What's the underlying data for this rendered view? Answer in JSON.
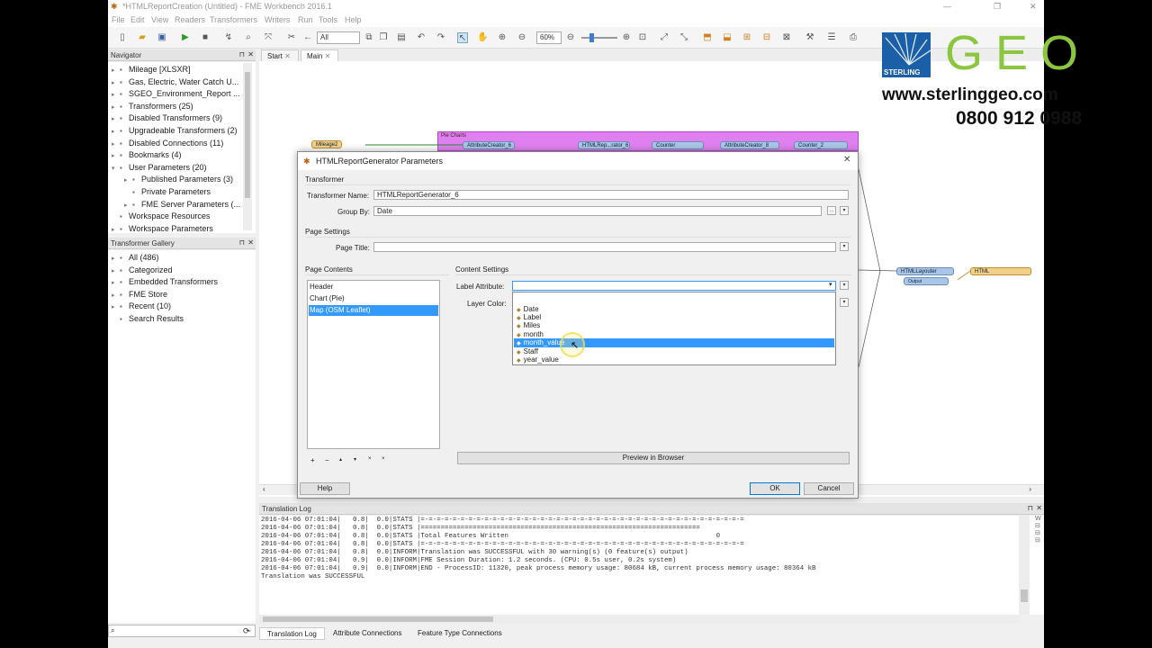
{
  "window": {
    "title": "*HTMLReportCreation (Untitled) - FME Workbench 2016.1",
    "controls": [
      "—",
      "❐",
      "✕"
    ]
  },
  "menu": [
    "File",
    "Edit",
    "View",
    "Readers",
    "Transformers",
    "Writers",
    "Run",
    "Tools",
    "Help"
  ],
  "toolbar": {
    "filter_value": "All",
    "zoom_value": "60%"
  },
  "navigator": {
    "title": "Navigator",
    "items": [
      {
        "label": "Mileage [XLSXR]",
        "indent": 0,
        "arrow": "▸"
      },
      {
        "label": "Gas, Electric, Water Catch U...",
        "indent": 0,
        "arrow": "▸"
      },
      {
        "label": "SGEO_Environment_Report ...",
        "indent": 0,
        "arrow": "▸"
      },
      {
        "label": "Transformers (25)",
        "indent": 0,
        "arrow": "▸"
      },
      {
        "label": "Disabled Transformers (9)",
        "indent": 0,
        "arrow": "▸"
      },
      {
        "label": "Upgradeable Transformers (2)",
        "indent": 0,
        "arrow": "▸"
      },
      {
        "label": "Disabled Connections (11)",
        "indent": 0,
        "arrow": "▸"
      },
      {
        "label": "Bookmarks (4)",
        "indent": 0,
        "arrow": "▸"
      },
      {
        "label": "User Parameters (20)",
        "indent": 0,
        "arrow": "▾"
      },
      {
        "label": "Published Parameters (3)",
        "indent": 1,
        "arrow": "▸"
      },
      {
        "label": "Private Parameters",
        "indent": 1,
        "arrow": ""
      },
      {
        "label": "FME Server Parameters (...",
        "indent": 1,
        "arrow": "▸"
      },
      {
        "label": "Workspace Resources",
        "indent": 0,
        "arrow": ""
      },
      {
        "label": "Workspace Parameters",
        "indent": 0,
        "arrow": "▸"
      }
    ]
  },
  "gallery": {
    "title": "Transformer Gallery",
    "items": [
      {
        "label": "All (486)",
        "arrow": "▸"
      },
      {
        "label": "Categorized",
        "arrow": "▸"
      },
      {
        "label": "Embedded Transformers",
        "arrow": "▸"
      },
      {
        "label": "FME Store",
        "arrow": "▸"
      },
      {
        "label": "Recent (10)",
        "arrow": "▸"
      },
      {
        "label": "Search Results",
        "arrow": ""
      }
    ],
    "search_placeholder": ""
  },
  "tabs": [
    {
      "label": "Start"
    },
    {
      "label": "Main"
    }
  ],
  "canvas": {
    "bookmark_label": "Pie Charts",
    "nodes": [
      "Mileage2",
      "AttributeCreator_6",
      "HTMLRep...rator_6",
      "Counter",
      "AttributeCreator_8",
      "Counter_2",
      "HTMLLayouter",
      "Output",
      "HTML"
    ]
  },
  "dialog": {
    "title": "HTMLReportGenerator Parameters",
    "transformer_section": "Transformer",
    "transformer_name_label": "Transformer Name:",
    "transformer_name_value": "HTMLReportGenerator_6",
    "group_by_label": "Group By:",
    "group_by_value": "Date",
    "page_settings_section": "Page Settings",
    "page_title_label": "Page Title:",
    "page_title_value": "",
    "page_contents_section": "Page Contents",
    "page_contents": [
      "Header",
      "Chart (Pie)",
      "Map (OSM Leaflet)"
    ],
    "selected_content": "Map (OSM Leaflet)",
    "content_settings_section": "Content Settings",
    "label_attribute_label": "Label Attribute:",
    "label_attribute_value": "",
    "layer_color_label": "Layer Color:",
    "dropdown_options": [
      "Date",
      "Label",
      "Miles",
      "month",
      "month_value",
      "Staff",
      "year_value"
    ],
    "dropdown_highlighted": "month_value",
    "list_tools": [
      "+",
      "−",
      "▴",
      "▾",
      "×",
      "×"
    ],
    "preview_button": "Preview in Browser",
    "help_button": "Help",
    "ok_button": "OK",
    "cancel_button": "Cancel",
    "ellipsis": "..."
  },
  "translation_log": {
    "title": "Translation Log",
    "lines": [
      "2016-04-06 07:01:04|   0.8|  0.0|STATS |=-=-=-=-=-=-=-=-=-=-=-=-=-=-=-=-=-=-=-=-=-=-=-=-=-=-=-=-=-=-=-=-=-=-=-=-=-=-=-=-=",
      "2016-04-06 07:01:04|   0.8|  0.0|STATS |======================================================================",
      "2016-04-06 07:01:04|   0.8|  0.0|STATS |Total Features Written                                                    0",
      "2016-04-06 07:01:04|   0.8|  0.0|STATS |=-=-=-=-=-=-=-=-=-=-=-=-=-=-=-=-=-=-=-=-=-=-=-=-=-=-=-=-=-=-=-=-=-=-=-=-=-=-=-=-=",
      "2016-04-06 07:01:04|   0.8|  0.0|INFORM|Translation was SUCCESSFUL with 30 warning(s) (0 feature(s) output)",
      "2016-04-06 07:01:04|   0.9|  0.0|INFORM|FME Session Duration: 1.2 seconds. (CPU: 0.5s user, 0.2s system)",
      "2016-04-06 07:01:04|   0.9|  0.0|INFORM|END - ProcessID: 11320, peak process memory usage: 80684 kB, current process memory usage: 80364 kB",
      "Translation was SUCCESSFUL"
    ]
  },
  "bottom_tabs": [
    "Translation Log",
    "Attribute Connections",
    "Feature Type Connections"
  ],
  "branding": {
    "company": "STERLING",
    "geo": "GEO",
    "website": "www.sterlinggeo.com",
    "phone": "0800 912 0988"
  },
  "colors": {
    "selection": "#3399ff",
    "bookmark": "#e080f0",
    "node": "#a9c6e8",
    "geo_green": "#8cc63f",
    "logo_blue": "#1b5fa8"
  }
}
